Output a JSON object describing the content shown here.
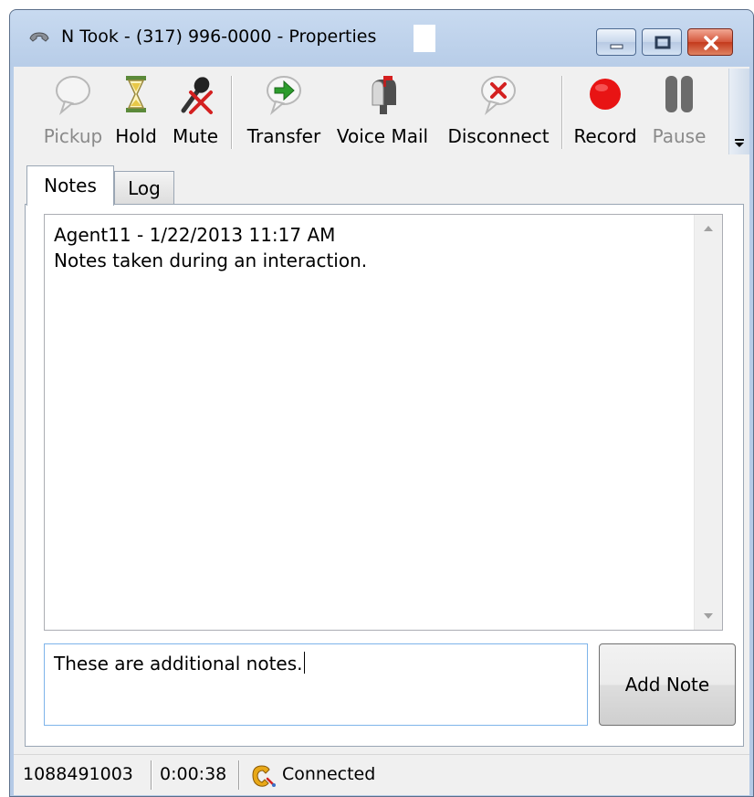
{
  "window": {
    "title": "N Took - (317) 996-0000 - Properties",
    "icon": "phone-handset-icon"
  },
  "toolbar": {
    "items": [
      {
        "label": "Pickup",
        "icon": "speech-bubble-icon",
        "enabled": false
      },
      {
        "label": "Hold",
        "icon": "hourglass-icon",
        "enabled": true
      },
      {
        "label": "Mute",
        "icon": "muted-microphone-icon",
        "enabled": true
      },
      {
        "label": "Transfer",
        "icon": "transfer-arrow-icon",
        "enabled": true
      },
      {
        "label": "Voice Mail",
        "icon": "mailbox-icon",
        "enabled": true
      },
      {
        "label": "Disconnect",
        "icon": "disconnect-icon",
        "enabled": true
      },
      {
        "label": "Record",
        "icon": "record-dot-icon",
        "enabled": true
      },
      {
        "label": "Pause",
        "icon": "pause-icon",
        "enabled": false
      }
    ]
  },
  "tabs": [
    {
      "label": "Notes",
      "active": true
    },
    {
      "label": "Log",
      "active": false
    }
  ],
  "notes": {
    "header": "Agent11 - 1/22/2013 11:17 AM",
    "body": "Notes taken during an interaction."
  },
  "new_note": {
    "value": "These are additional notes."
  },
  "add_note_button": "Add Note",
  "status": {
    "call_id": "1088491003",
    "duration": "0:00:38",
    "state": "Connected",
    "state_icon": "phone-connected-icon"
  },
  "colors": {
    "record_red": "#e81414",
    "transfer_green": "#2c9c2c",
    "disconnect_red": "#d42020",
    "input_focus_border": "#7eb4ea"
  }
}
